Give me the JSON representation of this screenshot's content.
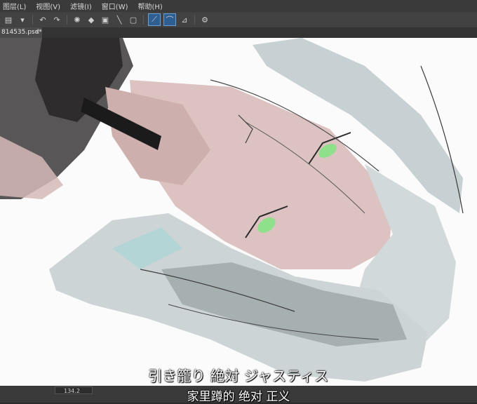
{
  "menu": {
    "items": [
      "图层(L)",
      "视图(V)",
      "滤镜(I)",
      "窗口(W)",
      "帮助(H)"
    ]
  },
  "document": {
    "tab_title": "814535.psd*",
    "close_glyph": "×"
  },
  "status": {
    "zoom": "134.2"
  },
  "subtitles": {
    "japanese": "引き籠り 絶対 ジャスティス",
    "chinese": "家里蹲的 绝对 正义"
  },
  "icons": [
    "layer-icon",
    "undo-icon",
    "redo-icon",
    "loading-icon",
    "fill-icon",
    "transform-icon",
    "pen-tool-icon",
    "ruler-icon",
    "settings-icon"
  ],
  "colors": {
    "ui_dark": "#3a3a3a",
    "toolbar_active": "#2f5e93",
    "canvas": "#fbfbfb",
    "hair": "#cfd6d8",
    "skin": "#dcc2c0",
    "eye": "#8ee08a"
  }
}
